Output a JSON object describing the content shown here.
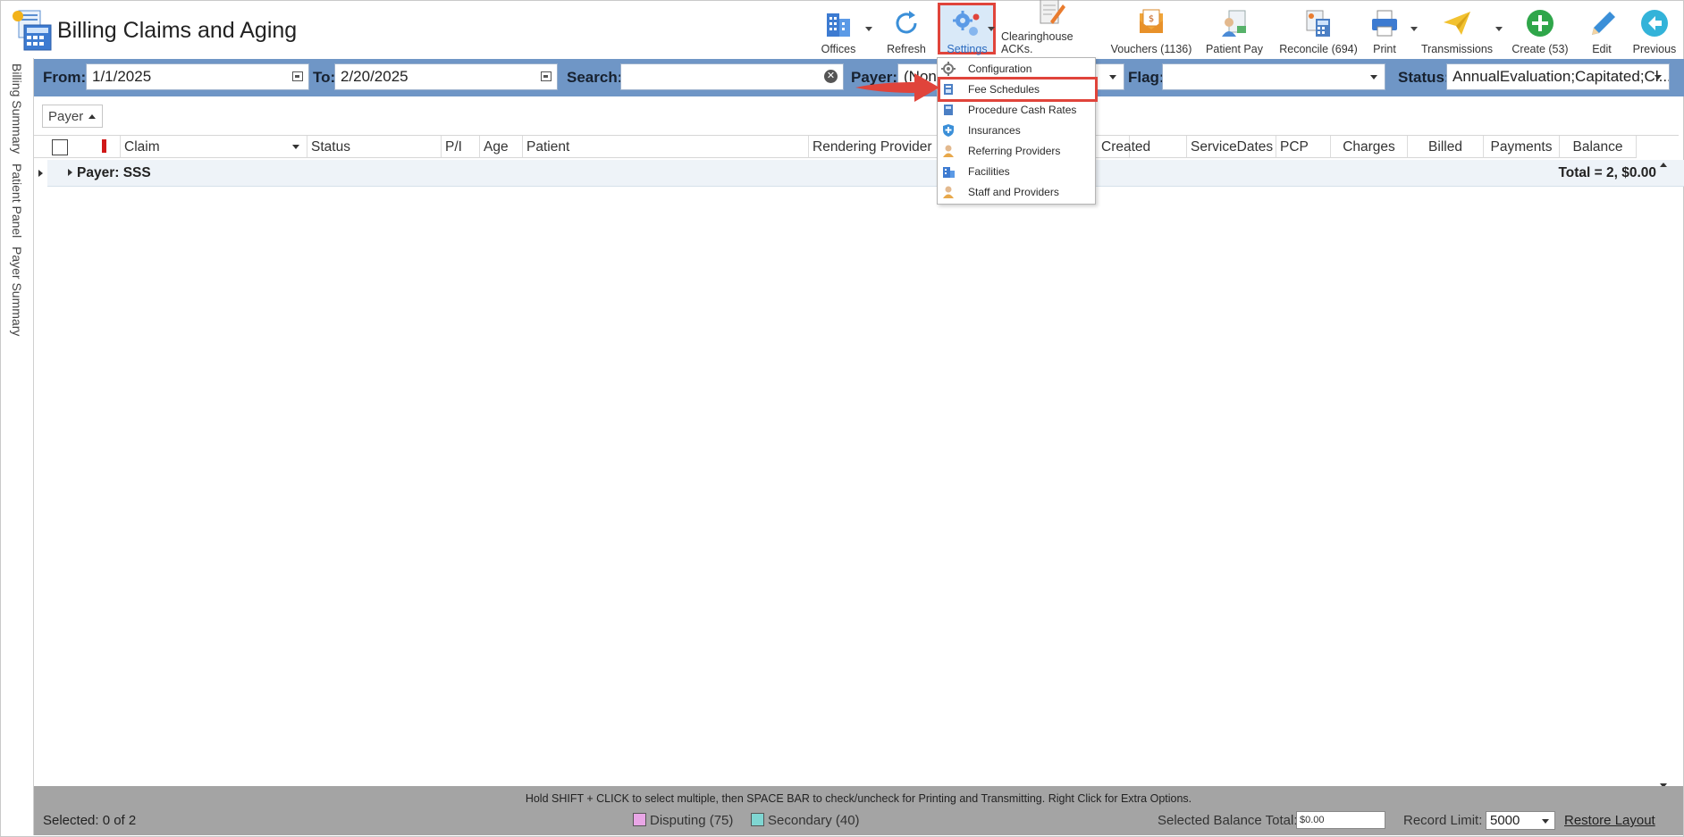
{
  "app": {
    "title": "Billing Claims and Aging"
  },
  "toolbar": {
    "offices": "Offices",
    "refresh": "Refresh",
    "settings": "Settings",
    "clearinghouse": "Clearinghouse ACKs.",
    "vouchers": "Vouchers (1136)",
    "patient_pay": "Patient Pay",
    "reconcile": "Reconcile (694)",
    "print": "Print",
    "transmissions": "Transmissions",
    "create": "Create (53)",
    "edit": "Edit",
    "previous": "Previous"
  },
  "side_tabs": [
    "Billing Summary",
    "Patient Panel",
    "Payer Summary"
  ],
  "filters": {
    "from_label": "From:",
    "from_value": "1/1/2025",
    "to_label": "To:",
    "to_value": "2/20/2025",
    "search_label": "Search:",
    "search_value": "",
    "payer_label": "Payer:",
    "payer_value": "(None",
    "flag_label": "Flag:",
    "flag_value": "",
    "status_label": "Status:",
    "status_value": "AnnualEvaluation;Capitated;Cl..."
  },
  "grouping": {
    "chip": "Payer"
  },
  "grid": {
    "columns": [
      "Claim",
      "Status",
      "P/I",
      "Age",
      "Patient",
      "Rendering Provider",
      "Created",
      "ServiceDates",
      "PCP",
      "Charges",
      "Billed",
      "Payments",
      "Balance"
    ],
    "group_label": "Payer: SSS",
    "group_total": "Total = 2,  $0.00"
  },
  "settings_menu": {
    "items": [
      "Configuration",
      "Fee Schedules",
      "Procedure Cash Rates",
      "Insurances",
      "Referring Providers",
      "Facilities",
      "Staff and Providers"
    ],
    "highlighted": "Fee Schedules"
  },
  "footer": {
    "hint": "Hold SHIFT + CLICK to select multiple, then SPACE BAR to check/uncheck for Printing and Transmitting. Right Click for Extra Options.",
    "selected": "Selected: 0 of 2",
    "disputing": "Disputing (75)",
    "secondary": "Secondary (40)",
    "selected_balance_label": "Selected Balance Total:",
    "selected_balance_value": "$0.00",
    "record_limit_label": "Record Limit:",
    "record_limit_value": "5000",
    "restore_layout": "Restore Layout"
  },
  "colors": {
    "filter_bar": "#6f96c6",
    "highlight": "#e0443b",
    "disputing": "#e9a6e6",
    "secondary": "#7fd6d2"
  }
}
